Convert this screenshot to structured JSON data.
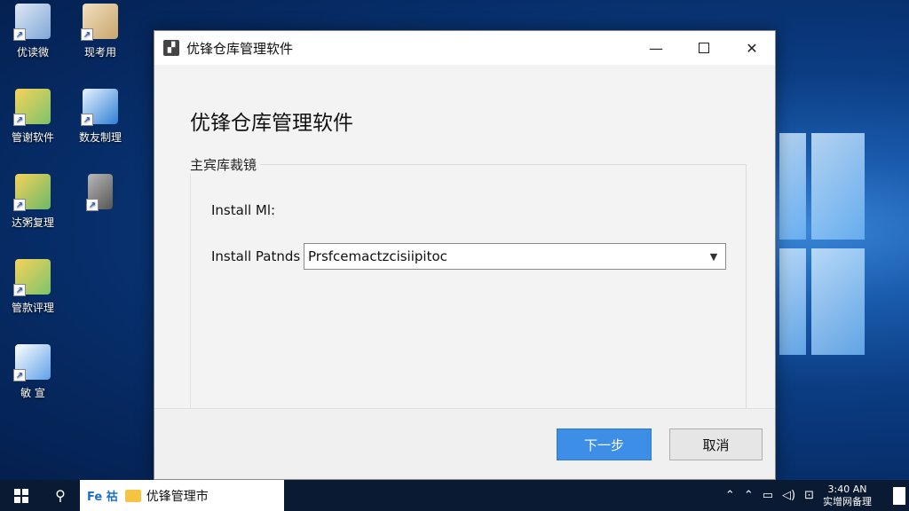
{
  "desktop": {
    "icons": [
      {
        "label": "优读微",
        "icon": "settings-app-icon"
      },
      {
        "label": "现考用",
        "icon": "package-box-icon"
      },
      {
        "label": "管谢软件",
        "icon": "folder-map-icon"
      },
      {
        "label": "数友制理",
        "icon": "blue-box-icon"
      },
      {
        "label": "达粥复理",
        "icon": "folder-doc-icon"
      },
      {
        "label": "",
        "icon": "device-icon"
      },
      {
        "label": "管款评理",
        "icon": "folder-map-icon"
      },
      {
        "label": "敏 宣",
        "icon": "document-icon"
      }
    ]
  },
  "dialog": {
    "title": "优锋仓库管理软件",
    "heading": "优锋仓库管理软件",
    "group_label": "主宾库裁镜",
    "install_label": "Install Ml:",
    "install_path_label": "Install Patnds",
    "install_path_value": "Prsfcemactzcisiipitoc",
    "next_button": "下一步",
    "cancel_button": "取消"
  },
  "taskbar": {
    "app_label": "优锋管理市",
    "app_icon_text": "Fe 祜",
    "time": "3:40 AN",
    "date": "实增网备理"
  },
  "colors": {
    "accent": "#3d8ee6",
    "taskbar": "#0b1a33",
    "desktop": "#0b3c82"
  }
}
